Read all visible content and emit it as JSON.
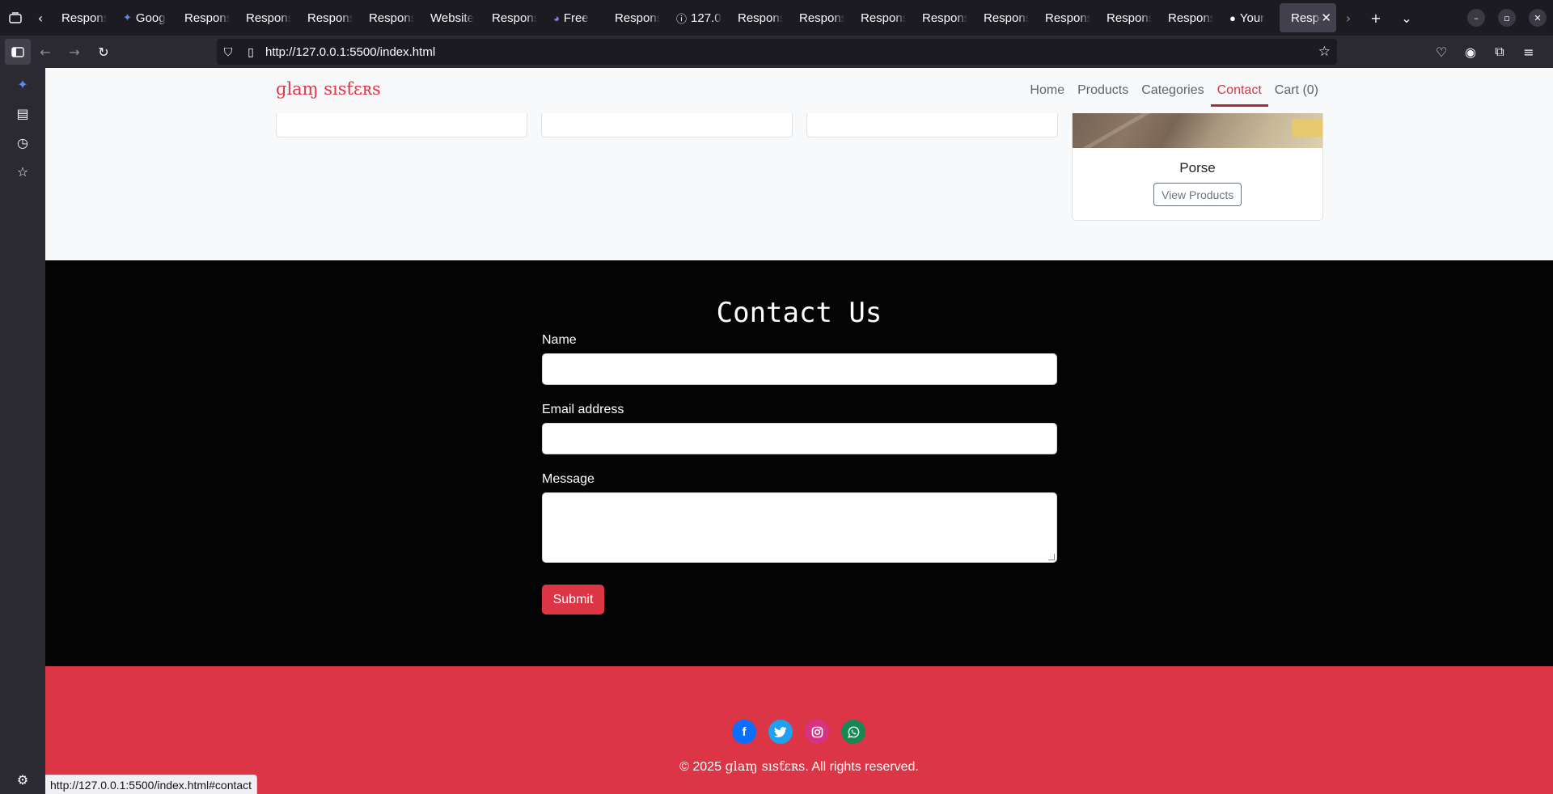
{
  "browser": {
    "tabs": [
      {
        "label": "Respons",
        "icon": ""
      },
      {
        "label": "Goog",
        "icon": "gemini-icon"
      },
      {
        "label": "Respons",
        "icon": ""
      },
      {
        "label": "Respons",
        "icon": ""
      },
      {
        "label": "Respons",
        "icon": ""
      },
      {
        "label": "Respons",
        "icon": ""
      },
      {
        "label": "Website",
        "icon": ""
      },
      {
        "label": "Respons",
        "icon": ""
      },
      {
        "label": "Free",
        "icon": "app-icon"
      },
      {
        "label": "Respons",
        "icon": ""
      },
      {
        "label": "127.0",
        "icon": "info-icon"
      },
      {
        "label": "Respons",
        "icon": ""
      },
      {
        "label": "Respons",
        "icon": ""
      },
      {
        "label": "Respons",
        "icon": ""
      },
      {
        "label": "Respons",
        "icon": ""
      },
      {
        "label": "Respons",
        "icon": ""
      },
      {
        "label": "Respons",
        "icon": ""
      },
      {
        "label": "Respons",
        "icon": ""
      },
      {
        "label": "Respons",
        "icon": ""
      },
      {
        "label": "Your",
        "icon": "github-icon"
      }
    ],
    "active_tab": "Respo",
    "url": "http://127.0.0.1:5500/index.html",
    "status_url": "http://127.0.0.1:5500/index.html#contact"
  },
  "site": {
    "brand": "ɡlaɱ sısƭɛʀs",
    "nav": [
      "Home",
      "Products",
      "Categories",
      "Contact",
      "Cart (0)"
    ],
    "active_nav": "Contact"
  },
  "categories": {
    "view_label": "View Products",
    "card_title": "Porse"
  },
  "contact": {
    "heading": "Contact Us",
    "name_label": "Name",
    "email_label": "Email address",
    "message_label": "Message",
    "submit_label": "Submit"
  },
  "footer": {
    "social_icons": [
      "facebook-icon",
      "twitter-icon",
      "instagram-icon",
      "whatsapp-icon"
    ],
    "copyright_prefix": "© 2025",
    "copyright_brand": "ɡlaɱ sısƭɛʀs",
    "copyright_suffix": ". All rights reserved."
  },
  "colors": {
    "brand": "#dc3545",
    "nav_active_underline": "#b02a37",
    "contact_bg": "#040404",
    "footer_bg": "#dc3545"
  }
}
